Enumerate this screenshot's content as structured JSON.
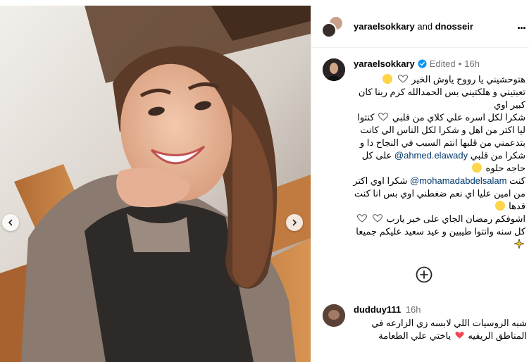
{
  "post": {
    "collab_owner": "yaraelsokkary",
    "collab_and": "and",
    "collab_partner": "dnosseir",
    "more_label": "..."
  },
  "caption": {
    "username": "yaraelsokkary",
    "edited": "Edited",
    "separator": "•",
    "time": "16h",
    "line1": "هتوحشيني يا رووح ياوش الخير",
    "line2": "تعبتيني و هلكتيني بس الحمدالله كرم ربنا كان كبير اوي",
    "line3a": "شكرا لكل اسره علي كلاي من قلبي",
    "line3b": "كنتوا ليا اكتر من اهل و شكرا لكل الناس الي  كانت بتدعمني من قلبها انتم السبب في النجاح دا و شكرا من قلبي",
    "mention1": "@ahmed.elawady",
    "line3c": "على",
    "line3d": "كل حاجه حلوه",
    "mention2": "@mohamadabdelsalam",
    "line4a": "كنت",
    "line4b": "شكرا اوي",
    "line4c": "اكتر من امين عليا اي نعم ضغطني اوي بس انا كنت قدها",
    "line5": "اشوفكم رمضان الجاي على خير يارب",
    "line6": "كل سنه وانتوا طيبين و عيد سعيد عليكم جميعا"
  },
  "comment": {
    "username": "dudduy111",
    "time": "16h",
    "text1": "شبه الروسيات اللي لابسه زي الزارعه في",
    "text2": "المناطق الريفيه",
    "text3": "ياختي علي الطعامة"
  },
  "icons": {
    "prev": "chevron-left-icon",
    "next": "chevron-right-icon",
    "more": "more-horizontal-icon",
    "verified": "verified-badge-icon",
    "load_more": "plus-circle-icon"
  },
  "colors": {
    "mention": "#00376b",
    "verified": "#0095f6",
    "muted": "#737373",
    "heart": "#ed4956"
  }
}
